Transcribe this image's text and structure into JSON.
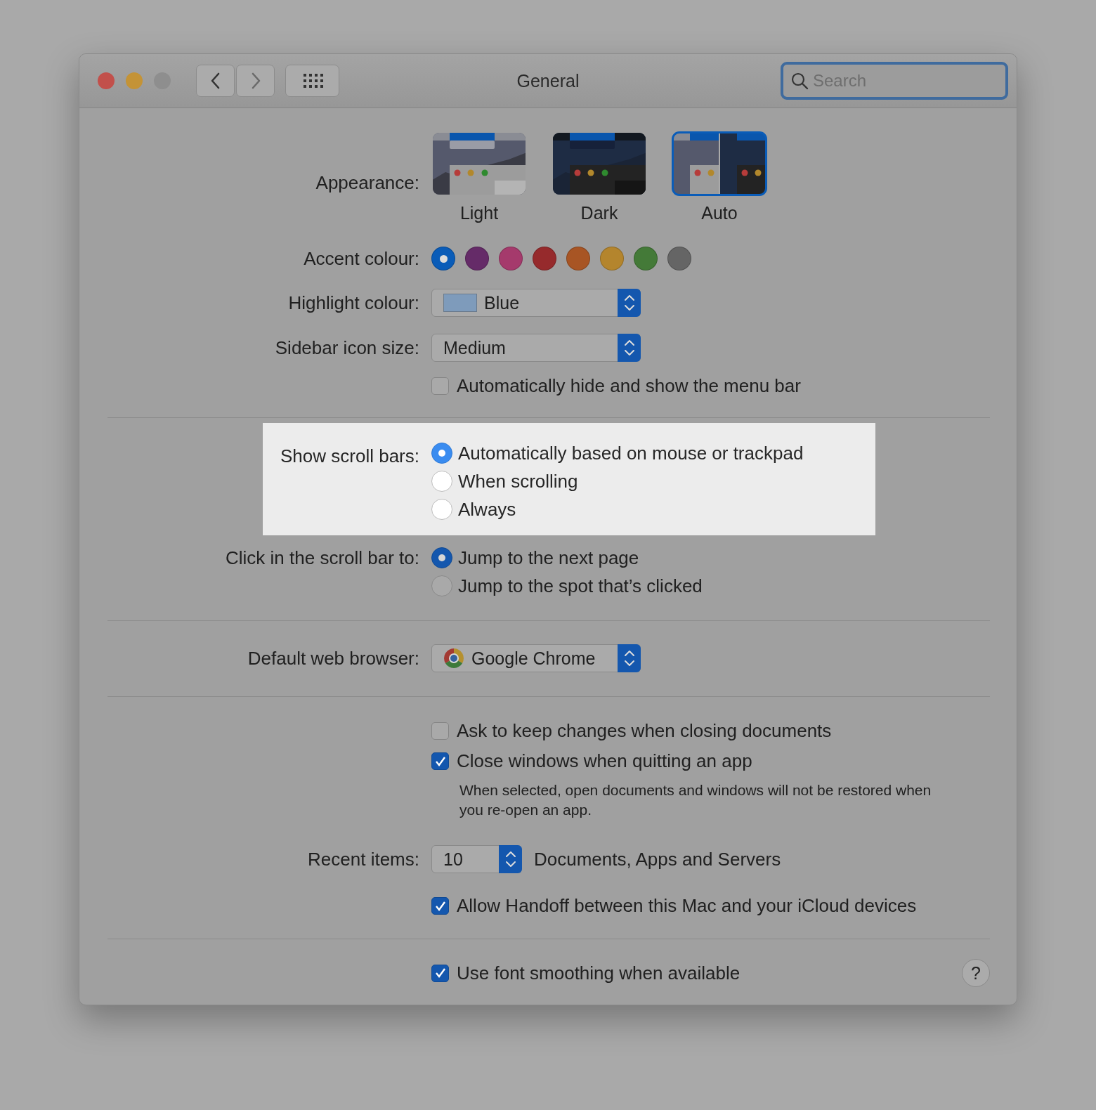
{
  "window": {
    "title": "General",
    "traffic_lights": [
      {
        "color": "#c2504b"
      },
      {
        "color": "#c49336"
      },
      {
        "color": "#8e8e8e"
      }
    ]
  },
  "search": {
    "placeholder": "Search"
  },
  "appearance": {
    "label": "Appearance:",
    "options": [
      {
        "label": "Light",
        "kind": "light",
        "selected": false
      },
      {
        "label": "Dark",
        "kind": "dark",
        "selected": false
      },
      {
        "label": "Auto",
        "kind": "auto",
        "selected": true
      }
    ]
  },
  "accent": {
    "label": "Accent colour:",
    "colors": [
      {
        "color": "#0a5cb8",
        "selected": true
      },
      {
        "color": "#652b68",
        "selected": false
      },
      {
        "color": "#a53a6c",
        "selected": false
      },
      {
        "color": "#962a2c",
        "selected": false
      },
      {
        "color": "#a85524",
        "selected": false
      },
      {
        "color": "#b4852d",
        "selected": false
      },
      {
        "color": "#447a38",
        "selected": false
      },
      {
        "color": "#656565",
        "selected": false
      }
    ]
  },
  "highlight_colour": {
    "label": "Highlight colour:",
    "value": "Blue",
    "color": "#7e9bbb"
  },
  "sidebar_icon_size": {
    "label": "Sidebar icon size:",
    "value": "Medium"
  },
  "menu_bar": {
    "label": "Automatically hide and show the menu bar",
    "checked": false
  },
  "show_scroll_bars": {
    "label": "Show scroll bars:",
    "highlighted": true,
    "options": [
      {
        "label": "Automatically based on mouse or trackpad",
        "selected": true
      },
      {
        "label": "When scrolling",
        "selected": false
      },
      {
        "label": "Always",
        "selected": false
      }
    ]
  },
  "click_scroll_bar": {
    "label": "Click in the scroll bar to:",
    "options": [
      {
        "label": "Jump to the next page",
        "selected": true
      },
      {
        "label": "Jump to the spot that’s clicked",
        "selected": false
      }
    ]
  },
  "default_browser": {
    "label": "Default web browser:",
    "value": "Google Chrome"
  },
  "document_options": [
    {
      "label": "Ask to keep changes when closing documents",
      "checked": false
    },
    {
      "label": "Close windows when quitting an app",
      "checked": true,
      "note": "When selected, open documents and windows will not be restored when you re-open an app."
    }
  ],
  "recent_items": {
    "label": "Recent items:",
    "value": "10",
    "suffix": "Documents, Apps and Servers"
  },
  "handoff": {
    "label": "Allow Handoff between this Mac and your iCloud devices",
    "checked": true
  },
  "font_smoothing": {
    "label": "Use font smoothing when available",
    "checked": true
  },
  "help": {
    "label": "?"
  }
}
